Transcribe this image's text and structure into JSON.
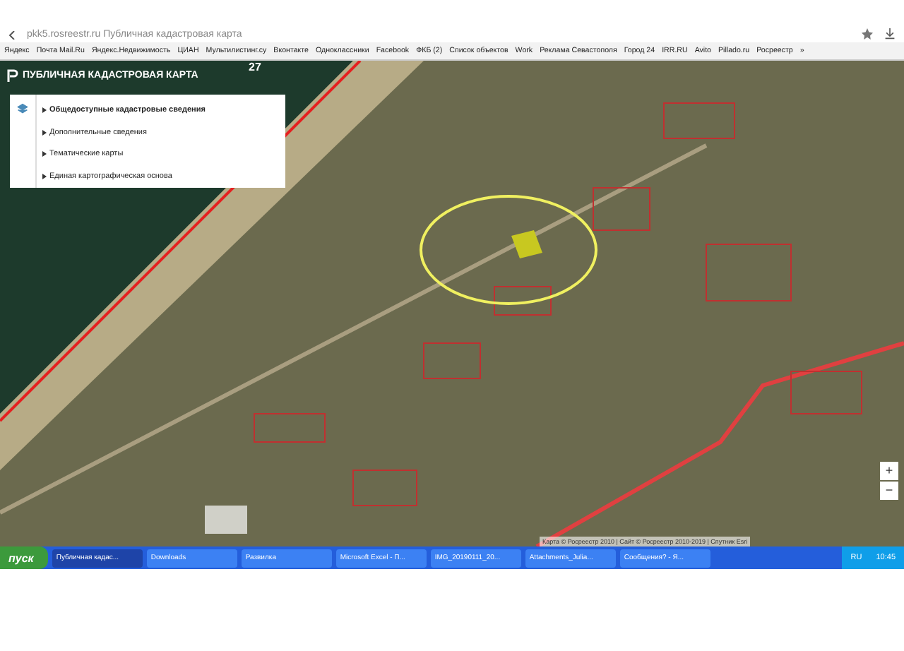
{
  "browser": {
    "address": "pkk5.rosreestr.ru  Публичная кадастровая карта"
  },
  "bookmarks": [
    "Яндекс",
    "Почта Mail.Ru",
    "Яндекс.Недвижимость",
    "ЦИАН",
    "Мультилистинг.су",
    "Вконтакте",
    "Одноклассники",
    "Facebook",
    "ФКБ (2)",
    "Список объектов",
    "Work",
    "Реклама Севастополя",
    "Город 24",
    "IRR.RU",
    "Avito",
    "Pillado.ru",
    "Росреестр",
    "»"
  ],
  "map": {
    "title": "ПУБЛИЧНАЯ КАДАСТРОВАЯ КАРТА",
    "label": "27",
    "menu": [
      {
        "label": "Общедоступные кадастровые сведения",
        "bold": true
      },
      {
        "label": "Дополнительные сведения",
        "bold": false
      },
      {
        "label": "Тематические карты",
        "bold": false
      },
      {
        "label": "Единая картографическая основа",
        "bold": false
      }
    ],
    "zoom_in": "+",
    "zoom_out": "−",
    "attribution": "Карта © Росреестр 2010 | Сайт © Росреестр 2010-2019 | Спутник Esri"
  },
  "taskbar": {
    "start": "пуск",
    "windows": [
      {
        "label": "Публичная кадас...",
        "selected": true
      },
      {
        "label": "Downloads",
        "selected": false
      },
      {
        "label": "Развилка",
        "selected": false
      },
      {
        "label": "Microsoft Excel - П...",
        "selected": false
      },
      {
        "label": "IMG_20190111_20...",
        "selected": false
      },
      {
        "label": "Attachments_Julia...",
        "selected": false
      },
      {
        "label": "Сообщения? - Я...",
        "selected": false
      }
    ],
    "lang": "RU",
    "time": "10:45"
  }
}
